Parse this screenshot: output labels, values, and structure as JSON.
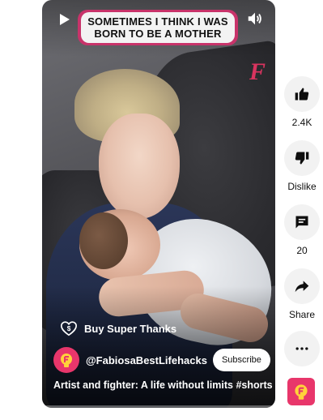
{
  "video": {
    "caption": "SOMETIMES I THINK I WAS BORN TO BE A MOTHER",
    "watermark": "F",
    "super_thanks_label": "Buy Super Thanks",
    "channel_handle": "@FabiosaBestLifehacks",
    "subscribe_label": "Subscribe",
    "title": "Artist and fighter: A life without limits #shorts",
    "icons": {
      "play": "play-icon",
      "volume": "volume-icon",
      "super_thanks": "super-thanks-icon"
    }
  },
  "actions": {
    "like": {
      "label": "2.4K",
      "icon": "thumbs-up-icon"
    },
    "dislike": {
      "label": "Dislike",
      "icon": "thumbs-down-icon"
    },
    "comments": {
      "label": "20",
      "icon": "comment-icon"
    },
    "share": {
      "label": "Share",
      "icon": "share-icon"
    },
    "more": {
      "icon": "more-horizontal-icon"
    }
  },
  "colors": {
    "brand": "#e8366b",
    "caption_border": "#c8336a",
    "action_bg": "#f2f2f2"
  }
}
